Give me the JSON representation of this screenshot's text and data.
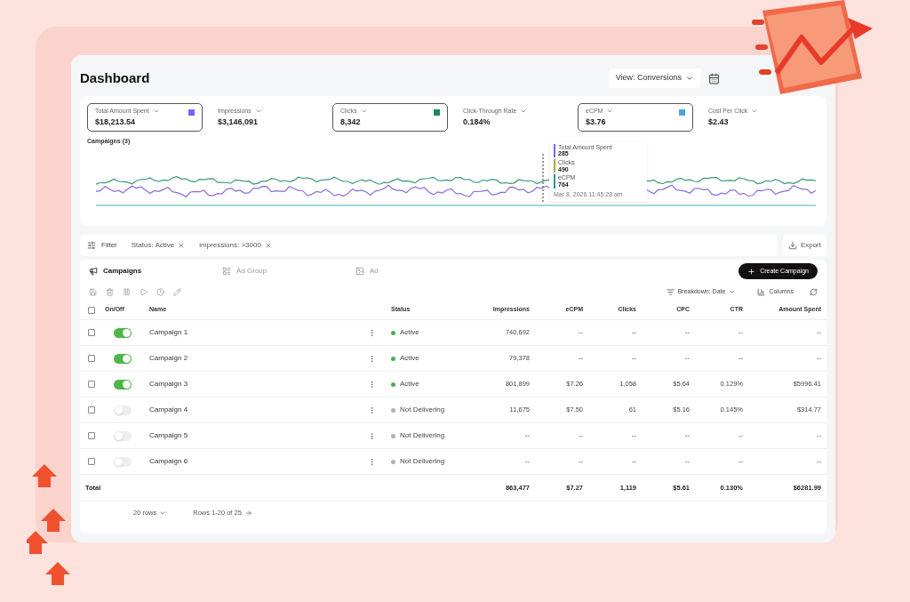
{
  "title": "Dashboard",
  "view_select": {
    "label": "View: Conversions"
  },
  "metrics": [
    {
      "label": "Total Amount Spent",
      "value": "$18,213.54",
      "selected": true,
      "color": "#7b61ff"
    },
    {
      "label": "Impressions",
      "value": "$3,146,091",
      "selected": false
    },
    {
      "label": "Clicks",
      "value": "8,342",
      "selected": true,
      "color": "#1e8a5a"
    },
    {
      "label": "Click-Through Rate",
      "value": "0.184%",
      "selected": false
    },
    {
      "label": "eCPM",
      "value": "$3.76",
      "selected": true,
      "color": "#4aa8d8"
    },
    {
      "label": "Cost Per Click",
      "value": "$2.43",
      "selected": false
    }
  ],
  "chart": {
    "title": "Campaigns (3)",
    "tooltip": {
      "items": [
        {
          "label": "Total Amount Spent",
          "value": "285",
          "color": "#7b61ff"
        },
        {
          "label": "Clicks",
          "value": "490",
          "color": "#a3b52a"
        },
        {
          "label": "eCPM",
          "value": "764",
          "color": "#2a8fa3"
        }
      ],
      "date": "Mar 8, 2026 11:45:28 am"
    }
  },
  "filter": {
    "label": "Filter",
    "chips": [
      "Status: Active",
      "impressions: >3000"
    ],
    "export": "Export"
  },
  "tabs": [
    {
      "label": "Campaigns",
      "selected": true
    },
    {
      "label": "Ad Group",
      "selected": false
    },
    {
      "label": "Ad",
      "selected": false
    }
  ],
  "create_button": "Create Campaign",
  "breakdown": "Breakdown: Date",
  "columns_button": "Columns",
  "table": {
    "all_checked": false,
    "toggle_column": "On/Off",
    "columns": [
      "Name",
      "Status",
      "Impressions",
      "eCPM",
      "Clicks",
      "CPC",
      "CTR",
      "Amount Spent"
    ],
    "rows": [
      {
        "checked": false,
        "on": true,
        "cells": [
          "Campaign 1",
          "Active",
          "740,692",
          "--",
          "--",
          "--",
          "--",
          "--"
        ],
        "color": "#4caf50"
      },
      {
        "checked": false,
        "on": true,
        "cells": [
          "Campaign 2",
          "Active",
          "79,378",
          "--",
          "--",
          "--",
          "--",
          "--"
        ],
        "color": "#4caf50"
      },
      {
        "checked": false,
        "on": true,
        "cells": [
          "Campaign 3",
          "Active",
          "801,899",
          "$7.26",
          "1,058",
          "$5.64",
          "0.129%",
          "$5996.41"
        ],
        "color": "#4caf50"
      },
      {
        "checked": false,
        "on": false,
        "cells": [
          "Campaign 4",
          "Not Delivering",
          "11,675",
          "$7.50",
          "61",
          "$5.16",
          "0.145%",
          "$314.77"
        ],
        "color": "#b0b0b0"
      },
      {
        "checked": false,
        "on": false,
        "cells": [
          "Campaign 5",
          "Not Delivering",
          "--",
          "--",
          "--",
          "--",
          "--",
          "--"
        ],
        "color": "#b0b0b0"
      },
      {
        "checked": false,
        "on": false,
        "cells": [
          "Campaign 6",
          "Not Delivering",
          "--",
          "--",
          "--",
          "--",
          "--",
          "--"
        ],
        "color": "#b0b0b0"
      }
    ],
    "total": {
      "label": "Total",
      "cells": [
        "863,477",
        "$7.27",
        "1,119",
        "$5.61",
        "0.130%",
        "$6281.99"
      ]
    }
  },
  "footer": {
    "per_page": "20 rows",
    "range": "Rows 1-20 of 25"
  }
}
